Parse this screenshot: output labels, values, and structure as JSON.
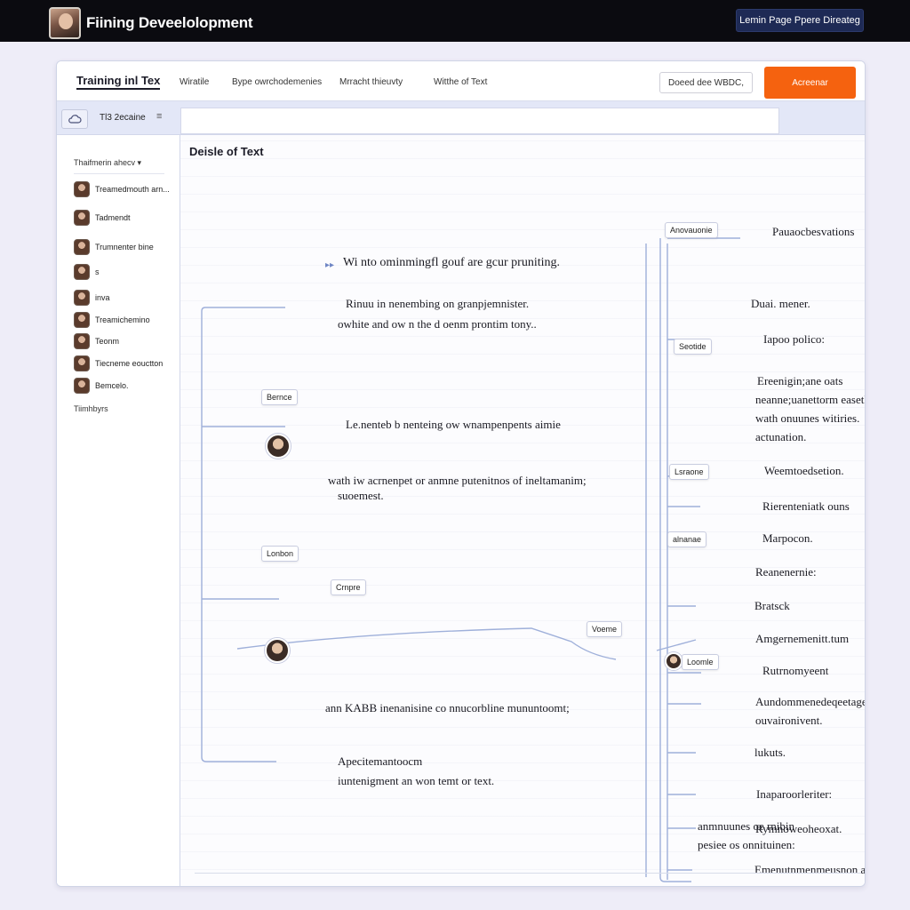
{
  "app": {
    "title": "Fiining Deveelolopment",
    "top_button": "Lemin Page Ppere Direateg"
  },
  "window": {
    "title": "Training inl Tex",
    "nav": [
      "Wiratile",
      "Bype owrchodemenies",
      "Mrracht thieuvty",
      "Witthe of Text"
    ],
    "search_value": "Doeed dee WBDC,",
    "primary_button": "Acreenar"
  },
  "toolbar": {
    "chip_icon": "cloud-icon",
    "label": "Tl3 2ecaine",
    "menu_glyph": "≡"
  },
  "sidebar": {
    "header": "Thaifmerin ahecv ▾",
    "items": [
      "Treamedmouth arn...",
      "Tadmendt",
      "Trumnenter bine",
      "s",
      "inva",
      "Treamichemino",
      "Teonm",
      "Tiecneme eouctton",
      "Bemcelo."
    ],
    "footer": "Tiimhbyrs"
  },
  "content": {
    "title": "Deisle of Text",
    "left": {
      "line1": "Wi nto ominmingfl gouf are gcur pruniting.",
      "line2a": "Rinuu in nenembing on granpjemnister.",
      "line2b": "owhite and ow n the d oenm prontim tony..",
      "line3": "Le.nenteb b nenteing ow wnampenpents aimie",
      "line4a": "wath iw acrnenpet or anmne putenitnos of ineltamanim;",
      "line4b": "suoemest.",
      "line5": "ann KABB inenanisine co nnucorbline mununtoomt;",
      "line6a": "Apecitemantoocm",
      "line6b": "iuntenigment an won temt or text.",
      "tags": [
        "Bernce",
        "Lonbon",
        "Crnpre",
        "Voeme"
      ]
    },
    "right": {
      "tags": [
        "Anovauonie",
        "Seotide",
        "Lsraone",
        "alnanae",
        "Loomle"
      ],
      "labels": [
        "Pauaocbesvations",
        "Duai. mener.",
        "Iapoo polico:",
        "Ereenigin;ane oats",
        "neanne;uanettorm easetha",
        "wath onuunes witiries.",
        "actunation.",
        "Weemtoedsetion.",
        "Rierenteniatk ouns",
        "Marpocon.",
        "Reanenernie:",
        "Bratsck",
        "Amgernemenitt.tum",
        "Rutrnomyeent",
        "Aundommenedeqeetages,",
        "ouvaironivent.",
        "lukuts.",
        "Inaparoorleriter:",
        "Rymnoweoheoxat.",
        "Emenutnmenmeusnon ann",
        "anmnuunes oe rnibin",
        "pesiee os onnituinen:"
      ]
    }
  }
}
